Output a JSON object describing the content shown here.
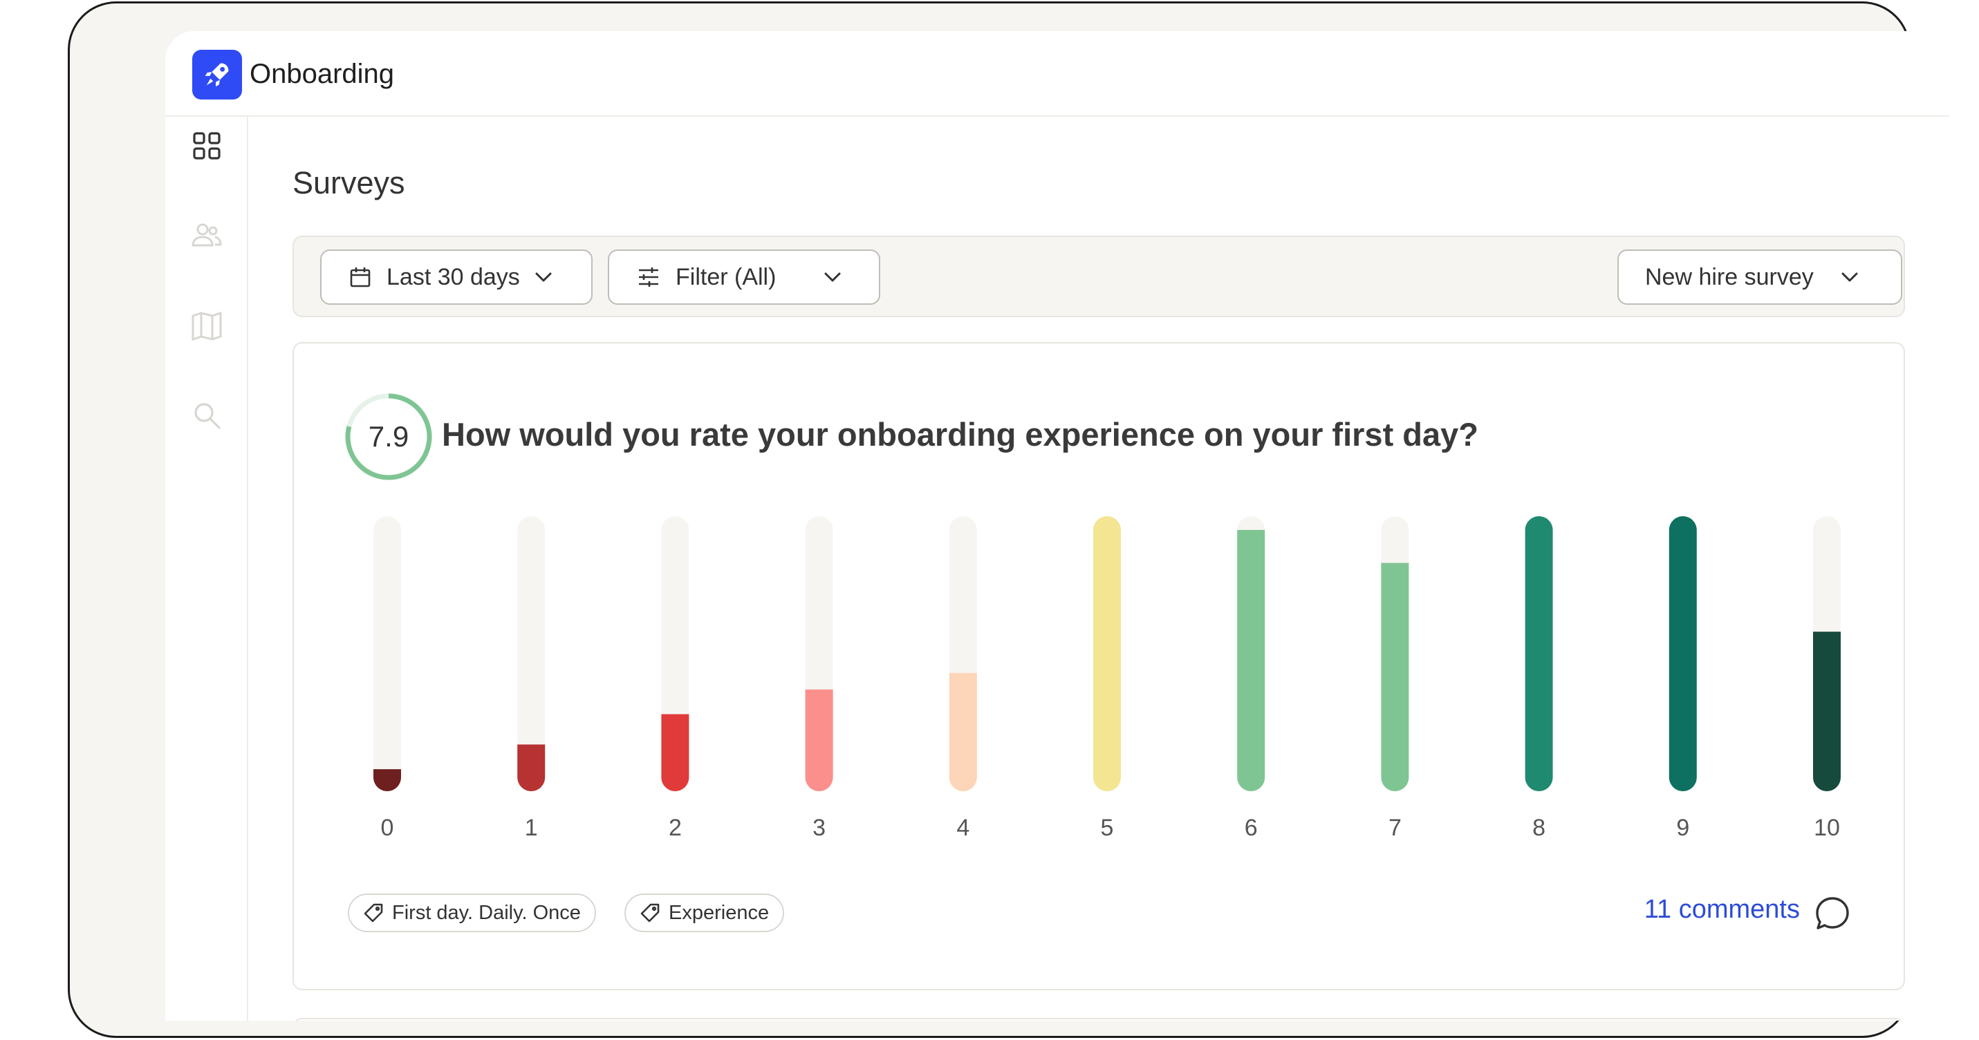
{
  "app": {
    "title": "Onboarding",
    "logo_icon": "rocket-icon",
    "brand_color": "#2f4bf5"
  },
  "sidebar": {
    "items": [
      {
        "icon": "grid-icon",
        "active": true
      },
      {
        "icon": "users-icon",
        "active": false
      },
      {
        "icon": "book-icon",
        "active": false
      },
      {
        "icon": "search-icon",
        "active": false
      }
    ]
  },
  "page": {
    "title": "Surveys"
  },
  "toolbar": {
    "date_range": "Last 30 days",
    "filter": "Filter (All)",
    "survey_select": "New hire survey"
  },
  "question_card": {
    "score": "7.9",
    "score_fraction": 0.79,
    "question": "How would you rate your onboarding experience on your first day?",
    "tags": [
      "First day. Daily. Once",
      "Experience"
    ],
    "comments_link": "11 comments"
  },
  "chart_data": {
    "type": "bar",
    "categories": [
      "0",
      "1",
      "2",
      "3",
      "4",
      "5",
      "6",
      "7",
      "8",
      "9",
      "10"
    ],
    "values": [
      0.08,
      0.17,
      0.28,
      0.37,
      0.43,
      1.0,
      0.95,
      0.83,
      1.0,
      1.0,
      0.58
    ],
    "ylim": [
      0,
      1
    ],
    "colors": [
      "#6e1f1f",
      "#b73232",
      "#e13a3a",
      "#fb8f8c",
      "#fdd5b8",
      "#f3e592",
      "#7fc593",
      "#7fc593",
      "#1f8a70",
      "#0e7060",
      "#164a3c"
    ],
    "track_color": "#f6f5f1"
  }
}
